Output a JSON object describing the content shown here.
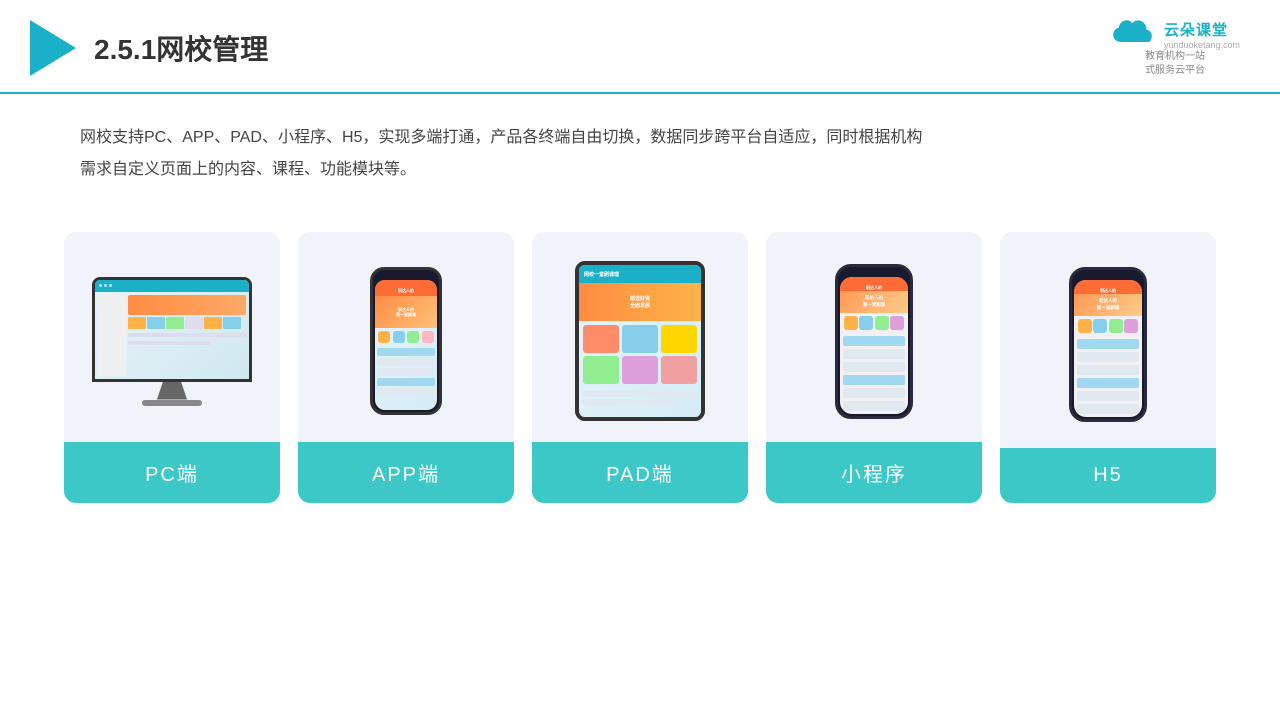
{
  "header": {
    "title": "2.5.1网校管理",
    "brand_name": "云朵课堂",
    "brand_url": "yunduoketang.com",
    "brand_slogan": "教育机构一站\n式服务云平台"
  },
  "description": {
    "text1": "网校支持PC、APP、PAD、小程序、H5，实现多端打通，产品各终端自由切换，数据同步跨平台自适应，同时根据机构",
    "text2": "需求自定义页面上的内容、课程、功能模块等。"
  },
  "cards": [
    {
      "id": "pc",
      "label": "PC端",
      "device_type": "monitor"
    },
    {
      "id": "app",
      "label": "APP端",
      "device_type": "phone"
    },
    {
      "id": "pad",
      "label": "PAD端",
      "device_type": "tablet"
    },
    {
      "id": "miniprogram",
      "label": "小程序",
      "device_type": "mini_phone"
    },
    {
      "id": "h5",
      "label": "H5",
      "device_type": "h5_phone"
    }
  ],
  "colors": {
    "accent": "#1ab0c8",
    "card_bg": "#eef2f8",
    "label_bg": "#3dc8c8"
  }
}
